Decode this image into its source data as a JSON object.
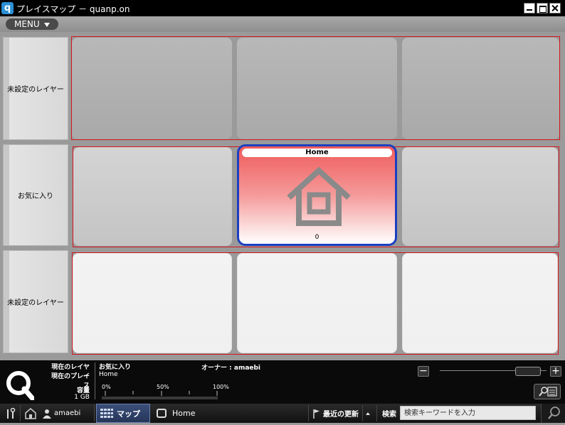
{
  "window": {
    "title": "プレイスマップ － quanp.on",
    "app_icon": "q"
  },
  "menu": {
    "label": "MENU"
  },
  "layers": [
    {
      "label": "未設定のレイヤー"
    },
    {
      "label": "お気に入り"
    },
    {
      "label": "未設定のレイヤー"
    }
  ],
  "home_tile": {
    "title": "Home",
    "count": "0",
    "icon": "house-icon"
  },
  "status": {
    "current_layer_label": "現在のレイヤー",
    "current_layer_value": "お気に入り",
    "current_place_label": "現在のプレイス",
    "current_place_value": "Home",
    "owner": "オーナー : amaebi",
    "capacity_label": "容量",
    "capacity_value": "1 GB",
    "gauge_0": "0%",
    "gauge_50": "50%",
    "gauge_100": "100%",
    "usage_percent": 0
  },
  "taskbar": {
    "user": "amaebi",
    "map_tab": "マップ",
    "home_tab": "Home",
    "recent_updates": "最近の更新",
    "search_label": "検索",
    "search_placeholder": "検索キーワードを入力"
  },
  "colors": {
    "layer_frame": "#d4141b",
    "home_border": "#1b3fc2",
    "home_top": "#ef5b5b"
  }
}
